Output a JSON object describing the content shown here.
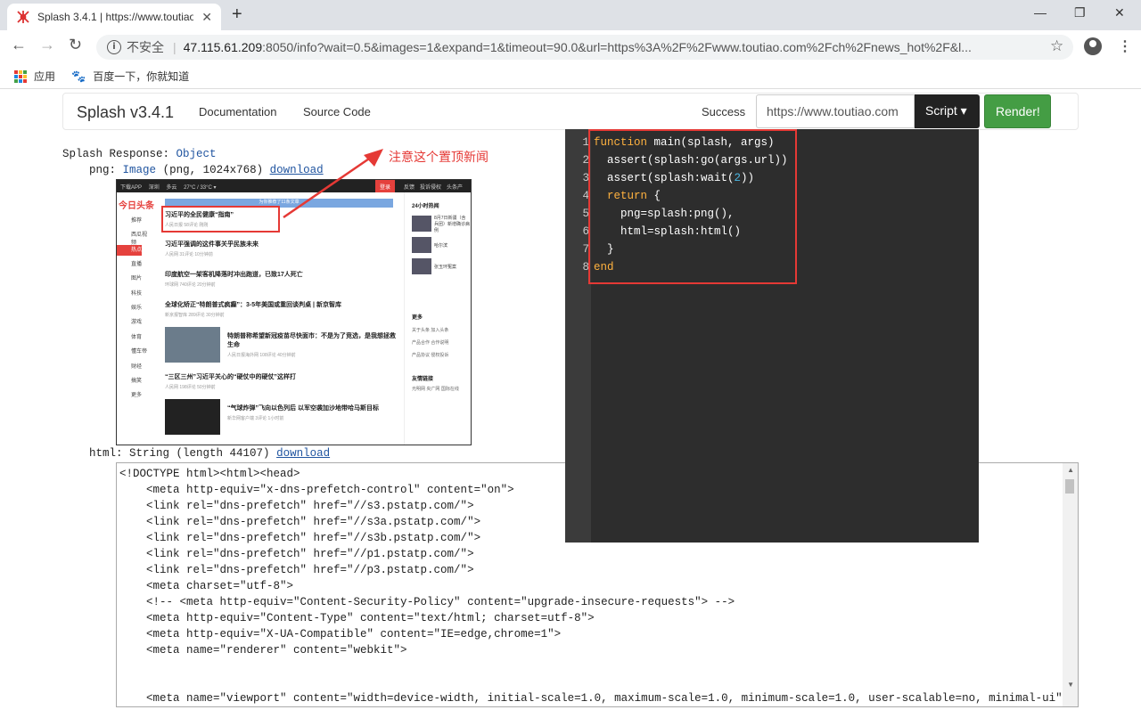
{
  "browser": {
    "tab_title": "Splash 3.4.1 | https://www.toutiao.com",
    "insecure_label": "不安全",
    "url_host": "47.115.61.209",
    "url_rest": ":8050/info?wait=0.5&images=1&expand=1&timeout=90.0&url=https%3A%2F%2Fwww.toutiao.com%2Fch%2Fnews_hot%2F&l...",
    "bookmarks": [
      "应用",
      "百度一下，你就知道"
    ]
  },
  "splash_nav": {
    "brand": "Splash v3.4.1",
    "links": [
      "Documentation",
      "Source Code"
    ],
    "status": "Success",
    "url_value": "https://www.toutiao.com",
    "script_label": "Script ▾",
    "render_label": "Render!"
  },
  "response": {
    "title_label": "Splash Response:",
    "title_type": "Object",
    "png_key": "png:",
    "png_type": "Image",
    "png_info": "(png, 1024x768)",
    "html_key": "html:",
    "html_info": "String (length 44107)",
    "download": "download"
  },
  "annotation": "注意这个置顶新闻",
  "screenshot": {
    "top_items": [
      "下载APP",
      "深圳",
      "多云",
      "27°C / 33°C ▾"
    ],
    "top_right": [
      "登录",
      "反馈",
      "投诉侵权",
      "头条产品"
    ],
    "logo": "今日头条",
    "banner": "为你推荐了11条文章",
    "sidebar": [
      "推荐",
      "西瓜视频",
      "热点",
      "直播",
      "图片",
      "科技",
      "娱乐",
      "游戏",
      "体育",
      "懂车帝",
      "财经",
      "搞笑",
      "更多"
    ],
    "news": [
      {
        "title": "习近平的全民健康“指南”",
        "meta": "人民日报  58评论  刚刚"
      },
      {
        "title": "习近平强调的这件事关乎民族未来",
        "meta": "人民网  31评论  10分钟前"
      },
      {
        "title": "印度航空一架客机降落时冲出跑道，已致17人死亡",
        "meta": "环球网  740评论  20分钟前"
      },
      {
        "title": "全球化矫正“特朗普式疯癫”：3-5年美国或重回谈判桌 | 新京智库",
        "meta": "新京报智库  289评论  30分钟前"
      },
      {
        "title": "特朗普称希望新冠疫苗尽快面市：不是为了竞选，是我想拯救生命",
        "meta": "人民日报海外网  108评论  40分钟前"
      },
      {
        "title": "“三区三州”习近平关心的“硬仗中的硬仗”这样打",
        "meta": "人民网  198评论  50分钟前"
      },
      {
        "title": "“气球炸弹”飞向以色列后 以军空袭加沙地带哈马斯目标",
        "meta": "新华网客户端  3评论  1小时前"
      }
    ],
    "right_heading": "24小时热闻",
    "right_items": [
      "8月7日新疆（含兵团）新增确诊病例",
      "哈尔滨",
      "张玉环冤案"
    ],
    "right_more": "更多",
    "right_links": [
      "关于头条",
      "加入头条",
      "产品合作",
      "合作说明",
      "产品协议",
      "侵权投诉"
    ],
    "friends": "友情链接",
    "friend_links": [
      "光明网",
      "央广网",
      "国际在线"
    ]
  },
  "editor": {
    "line_numbers": [
      "1",
      "2",
      "3",
      "4",
      "5",
      "6",
      "7",
      "8"
    ]
  },
  "html_content": "<!DOCTYPE html><html><head>\n    <meta http-equiv=\"x-dns-prefetch-control\" content=\"on\">\n    <link rel=\"dns-prefetch\" href=\"//s3.pstatp.com/\">\n    <link rel=\"dns-prefetch\" href=\"//s3a.pstatp.com/\">\n    <link rel=\"dns-prefetch\" href=\"//s3b.pstatp.com/\">\n    <link rel=\"dns-prefetch\" href=\"//p1.pstatp.com/\">\n    <link rel=\"dns-prefetch\" href=\"//p3.pstatp.com/\">\n    <meta charset=\"utf-8\">\n    <!-- <meta http-equiv=\"Content-Security-Policy\" content=\"upgrade-insecure-requests\"> -->\n    <meta http-equiv=\"Content-Type\" content=\"text/html; charset=utf-8\">\n    <meta http-equiv=\"X-UA-Compatible\" content=\"IE=edge,chrome=1\">\n    <meta name=\"renderer\" content=\"webkit\">\n\n\n    <meta name=\"viewport\" content=\"width=device-width, initial-scale=1.0, maximum-scale=1.0, minimum-scale=1.0, user-scalable=no, minimal-ui\">"
}
